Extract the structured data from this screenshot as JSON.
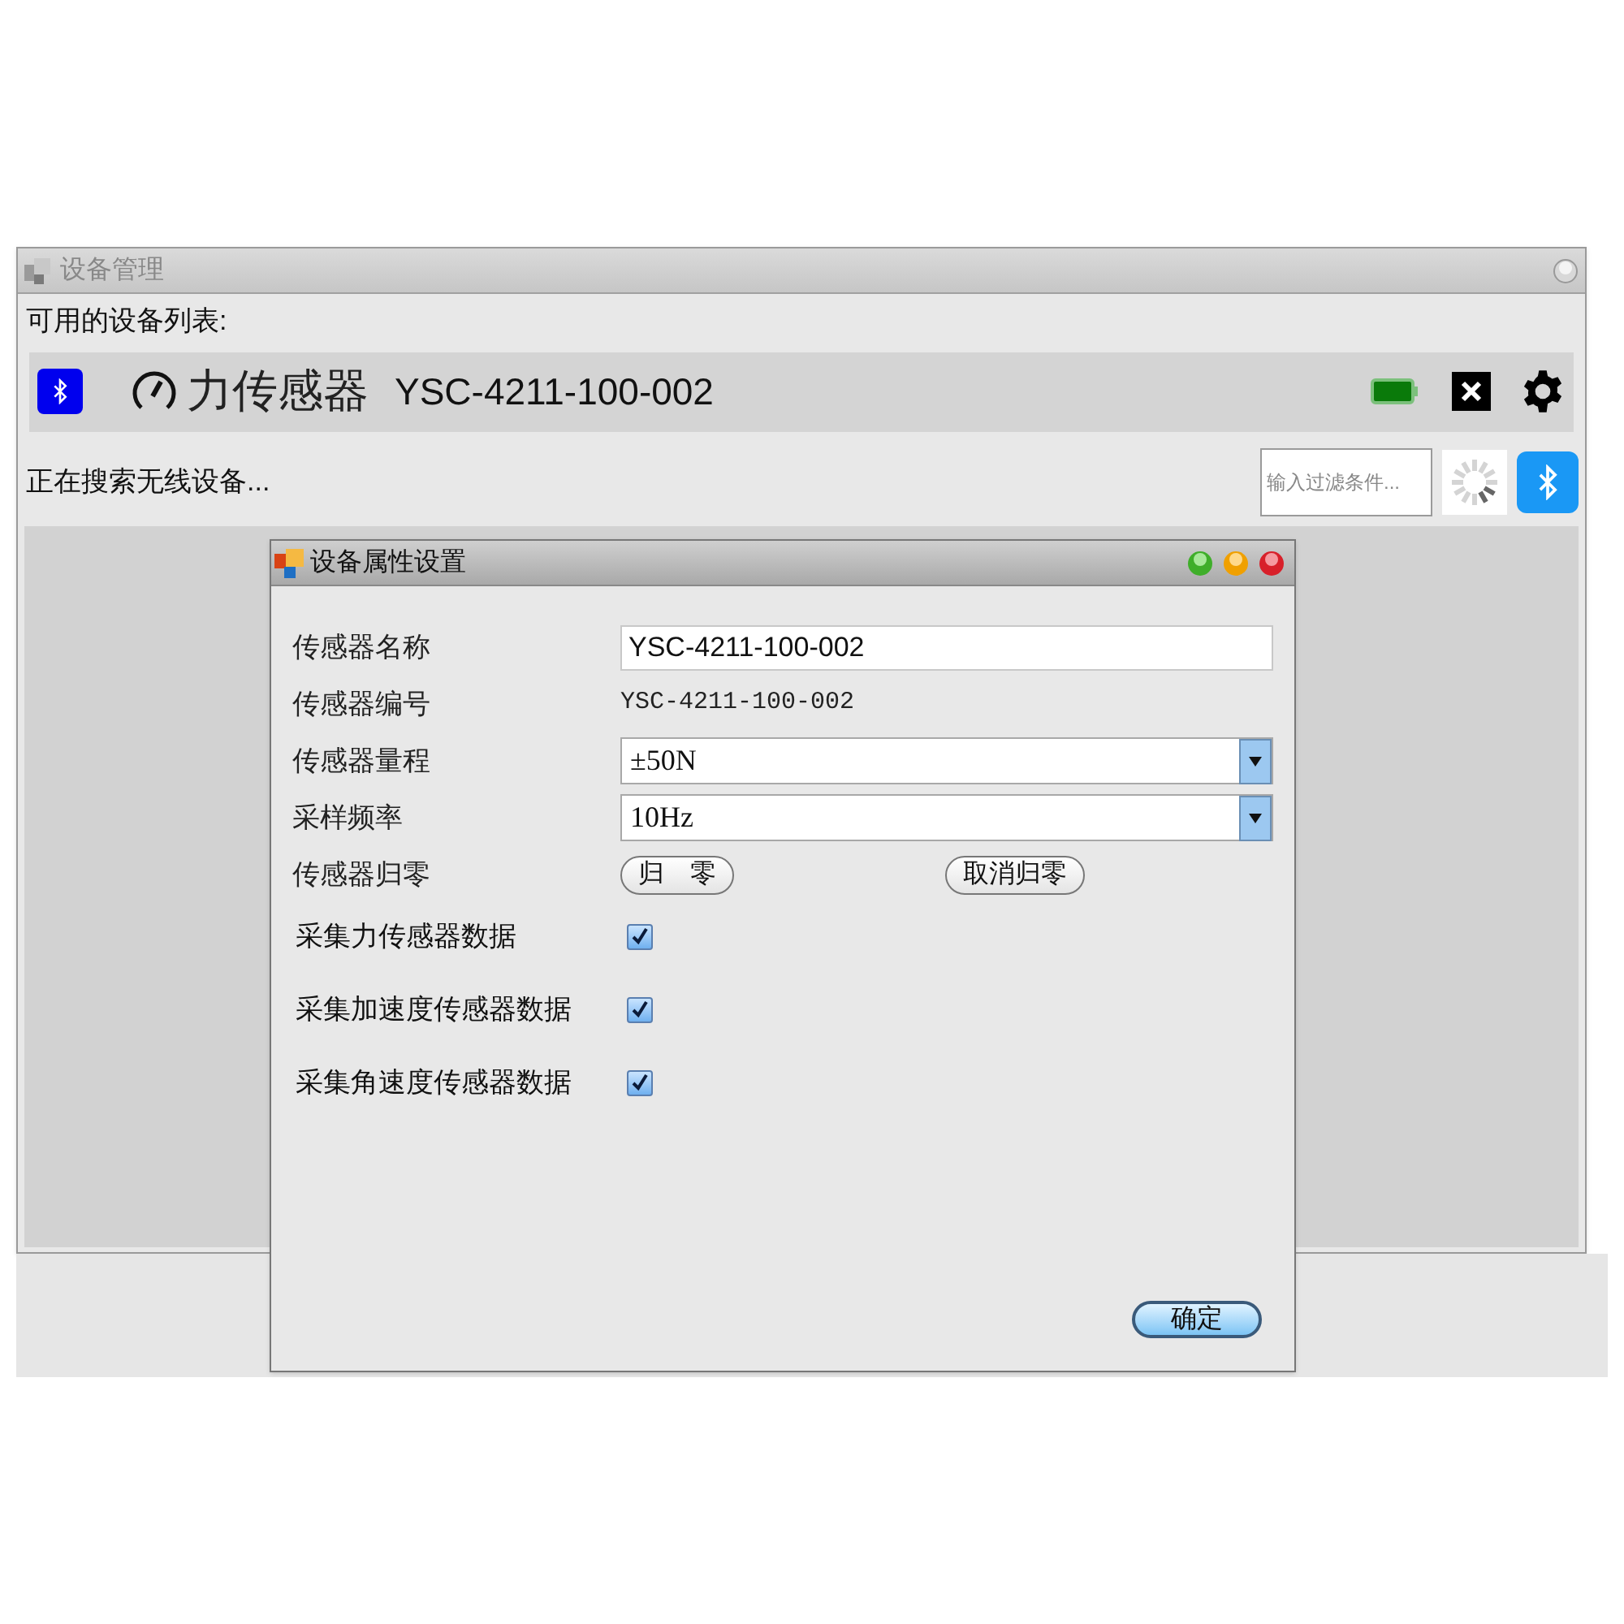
{
  "main_window": {
    "title": "设备管理",
    "list_label": "可用的设备列表:",
    "devices": [
      {
        "name": "力传感器",
        "serial": "YSC-4211-100-002"
      }
    ],
    "status": "正在搜索无线设备...",
    "filter": {
      "placeholder": "输入过滤条件..."
    }
  },
  "dialog": {
    "title": "设备属性设置",
    "fields": [
      {
        "kind": "text",
        "label": "传感器名称",
        "value": "YSC-4211-100-002"
      },
      {
        "kind": "static",
        "label": "传感器编号",
        "value": "YSC-4211-100-002"
      },
      {
        "kind": "select",
        "label": "传感器量程",
        "value": "±50N"
      },
      {
        "kind": "select",
        "label": "采样频率",
        "value": "10Hz"
      },
      {
        "kind": "buttons",
        "label": "传感器归零",
        "buttons": [
          "归　零",
          "取消归零"
        ]
      }
    ],
    "checks": [
      {
        "label": "采集力传感器数据",
        "checked": true
      },
      {
        "label": "采集加速度传感器数据",
        "checked": true
      },
      {
        "label": "采集角速度传感器数据",
        "checked": true
      }
    ],
    "ok": "确定"
  }
}
